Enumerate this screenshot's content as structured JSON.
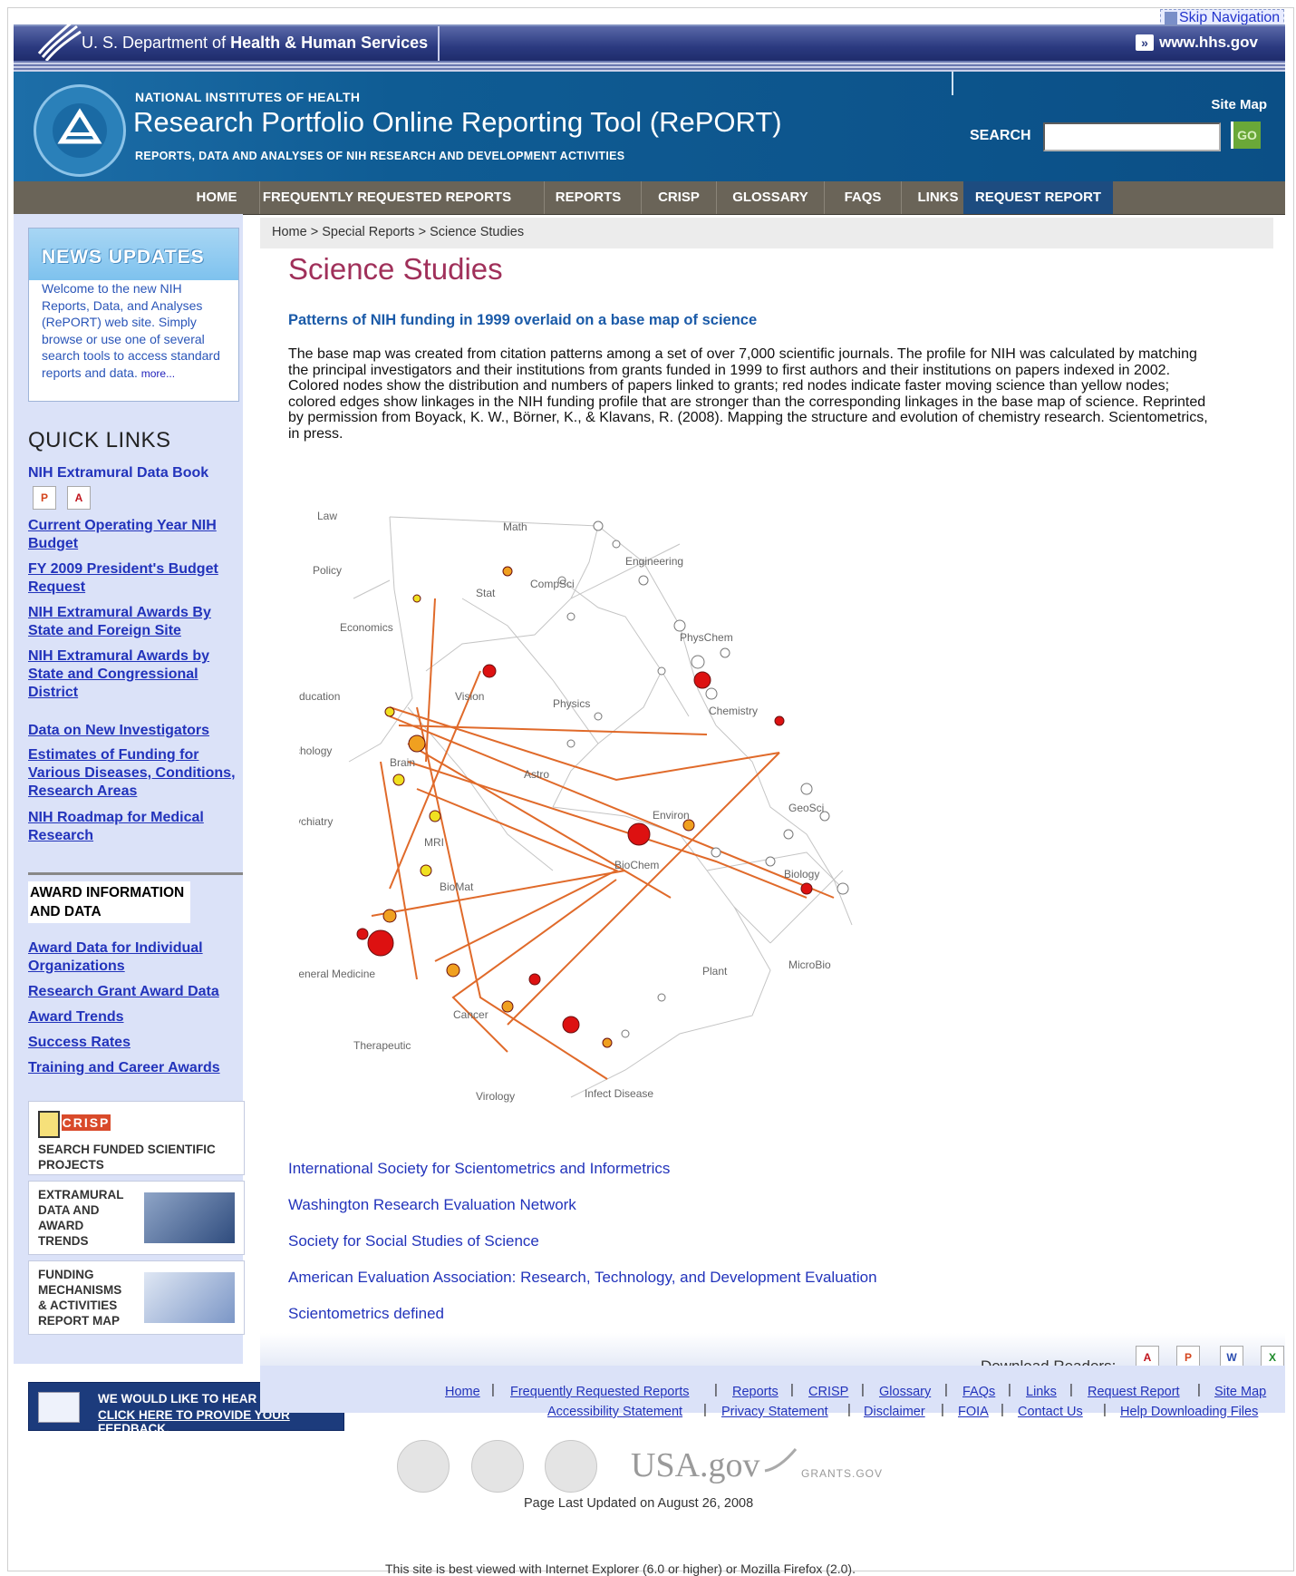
{
  "skip_nav": "Skip Navigation",
  "hhs": {
    "title_prefix": "U. S. Department of ",
    "title_bold": "Health & Human Services",
    "www": "www.hhs.gov"
  },
  "header": {
    "org": "NATIONAL INSTITUTES OF HEALTH",
    "tool": "Research Portfolio Online Reporting Tool (RePORT)",
    "tagline": "REPORTS, DATA AND ANALYSES OF NIH RESEARCH AND DEVELOPMENT ACTIVITIES",
    "site_map": "Site Map",
    "search_label": "SEARCH",
    "search_value": "",
    "go": "GO"
  },
  "nav": [
    "HOME",
    "FREQUENTLY REQUESTED REPORTS",
    "REPORTS",
    "CRISP",
    "GLOSSARY",
    "FAQS",
    "LINKS",
    "REQUEST REPORT"
  ],
  "sidebar": {
    "news_title": "NEWS UPDATES",
    "news_text": "Welcome to the new NIH Reports, Data, and Analyses (RePORT) web site. Simply browse or use one of several search tools to access standard reports and data.",
    "news_more": "more...",
    "quick_links_title": "QUICK LINKS",
    "quick_links": [
      "NIH Extramural Data Book",
      "Current Operating Year NIH Budget",
      "FY 2009 President's Budget Request",
      "NIH Extramural Awards By State and Foreign Site",
      "NIH Extramural Awards by State and Congressional District",
      "Data on New Investigators",
      "Estimates of Funding for Various Diseases, Conditions, Research Areas",
      "NIH Roadmap for Medical Research"
    ],
    "award_title": "AWARD INFORMATION AND DATA",
    "award_links": [
      "Award Data for Individual Organizations",
      "Research Grant Award Data",
      "Award Trends",
      "Success Rates",
      "Training and Career Awards"
    ],
    "crisp_logo": "CRISP",
    "crisp_text": "SEARCH FUNDED SCIENTIFIC PROJECTS",
    "extramural_text": "EXTRAMURAL DATA AND AWARD TRENDS",
    "funding_text": "FUNDING MECHANISMS & ACTIVITIES REPORT MAP",
    "feedback_line1": "WE WOULD LIKE TO HEAR FROM YOU.",
    "feedback_line2": "CLICK HERE TO PROVIDE YOUR FEEDBACK."
  },
  "main": {
    "breadcrumb": "Home > Special Reports > Science Studies",
    "title": "Science Studies",
    "subtitle": "Patterns of NIH funding in 1999 overlaid on a base map of science",
    "paragraph": "The base map was created from citation patterns among a set of over 7,000 scientific journals. The profile for NIH was calculated by matching the principal investigators and their institutions from grants funded in 1999 to first authors and their institutions on papers indexed in 2002. Colored nodes show the distribution and numbers of papers linked to grants; red nodes indicate faster moving science than yellow nodes; colored edges show linkages in the NIH funding profile that are stronger than the corresponding linkages in the base map of science. Reprinted by permission from Boyack, K. W., Börner, K., & Klavans, R. (2008). Mapping the structure and evolution of chemistry research. Scientometrics, in press.",
    "map_labels": [
      "Law",
      "Math",
      "Engineering",
      "Policy",
      "Stat",
      "CompSci",
      "Economics",
      "PhysChem",
      "Education",
      "Vision",
      "Physics",
      "Chemistry",
      "Psychology",
      "Brain",
      "Astro",
      "GeoSci",
      "Psychiatry",
      "Environ",
      "MRI",
      "BioChem",
      "Biology",
      "BioMat",
      "General Medicine",
      "Plant",
      "MicroBio",
      "Cancer",
      "Therapeutic",
      "Virology",
      "Infect Disease"
    ],
    "links": [
      "International Society for Scientometrics and Informetrics",
      "Washington Research Evaluation Network",
      "Society for Social Studies of Science",
      "American Evaluation Association: Research, Technology, and Development Evaluation",
      "Scientometrics defined"
    ]
  },
  "footer": {
    "download_readers": "Download Readers:",
    "row1": [
      "Home",
      "Frequently Requested Reports",
      "Reports",
      "CRISP",
      "Glossary",
      "FAQs",
      "Links",
      "Request Report",
      "Site Map"
    ],
    "row2": [
      "Accessibility Statement",
      "Privacy Statement",
      "Disclaimer",
      "FOIA",
      "Contact Us",
      "Help Downloading Files"
    ],
    "usagov": "USA.gov",
    "grants": "GRANTS.GOV",
    "updated": "Page Last Updated on August 26, 2008",
    "best_viewed": "This site is best viewed with Internet Explorer (6.0 or higher) or Mozilla Firefox (2.0)."
  }
}
